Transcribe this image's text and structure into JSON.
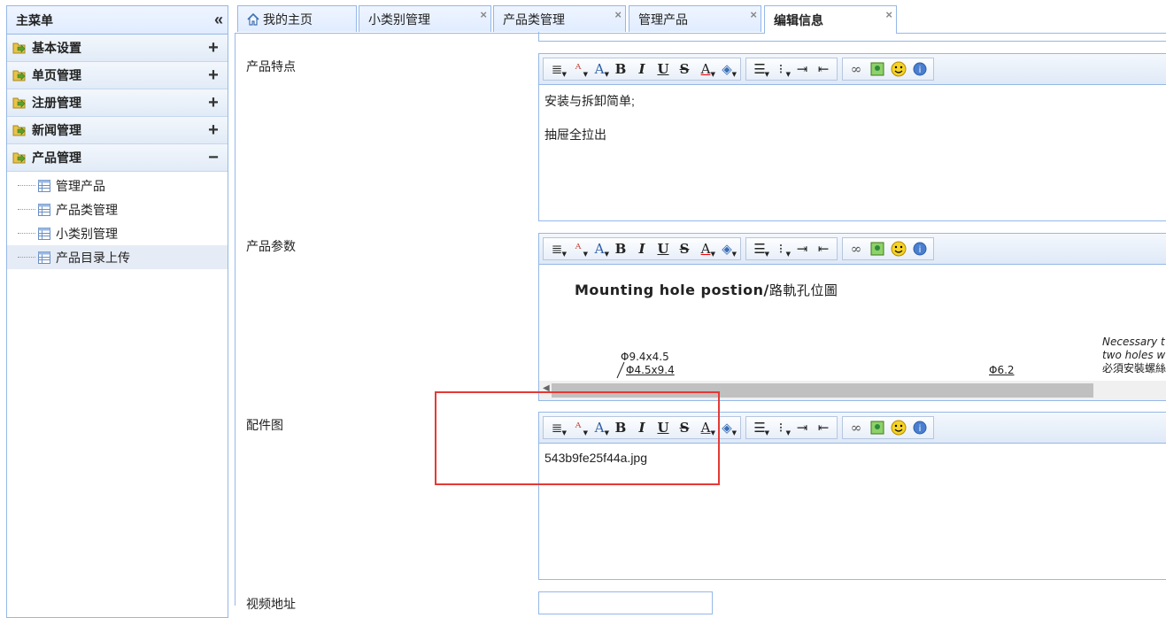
{
  "sidebar": {
    "title": "主菜单",
    "collapse_glyph": "«",
    "groups": [
      {
        "label": "基本设置",
        "toggle": "+"
      },
      {
        "label": "单页管理",
        "toggle": "+"
      },
      {
        "label": "注册管理",
        "toggle": "+"
      },
      {
        "label": "新闻管理",
        "toggle": "+"
      },
      {
        "label": "产品管理",
        "toggle": "−"
      }
    ],
    "items": [
      {
        "label": "管理产品"
      },
      {
        "label": "产品类管理"
      },
      {
        "label": "小类别管理"
      },
      {
        "label": "产品目录上传"
      }
    ]
  },
  "tabs": [
    {
      "label": "我的主页"
    },
    {
      "label": "小类别管理",
      "close": "×"
    },
    {
      "label": "产品类管理",
      "close": "×"
    },
    {
      "label": "管理产品",
      "close": "×"
    },
    {
      "label": "编辑信息",
      "close": "×"
    }
  ],
  "form": {
    "features_label": "产品特点",
    "features_lines": [
      "安装与拆卸简单;",
      "抽屉全拉出"
    ],
    "params_label": "产品参数",
    "params_image": {
      "title": "Mounting hole postion/",
      "title_cn": "路軌孔位圖",
      "dim1": "Φ9.4x4.5",
      "dim2": "Φ4.5x9.4",
      "dim3": "Φ6.2",
      "note1": "Necessary t",
      "note2": "two holes w",
      "note3": "必須安裝螺絲"
    },
    "parts_label": "配件图",
    "parts_value": "543b9fe25f44a.jpg",
    "video_label": "视频地址"
  },
  "toolbar_groups": [
    [
      "paragraph-icon",
      "font-family-icon",
      "font-size-icon",
      "bold-icon",
      "italic-icon",
      "underline-icon",
      "strikethrough-icon",
      "font-color-icon",
      "highlight-color-icon"
    ],
    [
      "align-left-icon",
      "unordered-list-icon",
      "indent-icon",
      "outdent-icon"
    ],
    [
      "link-icon",
      "image-icon",
      "emoticon-icon",
      "about-icon"
    ]
  ],
  "colors": {
    "border": "#95b8e7",
    "highlight_box": "#e53935",
    "active_item_bg": "#e6ecf5"
  }
}
